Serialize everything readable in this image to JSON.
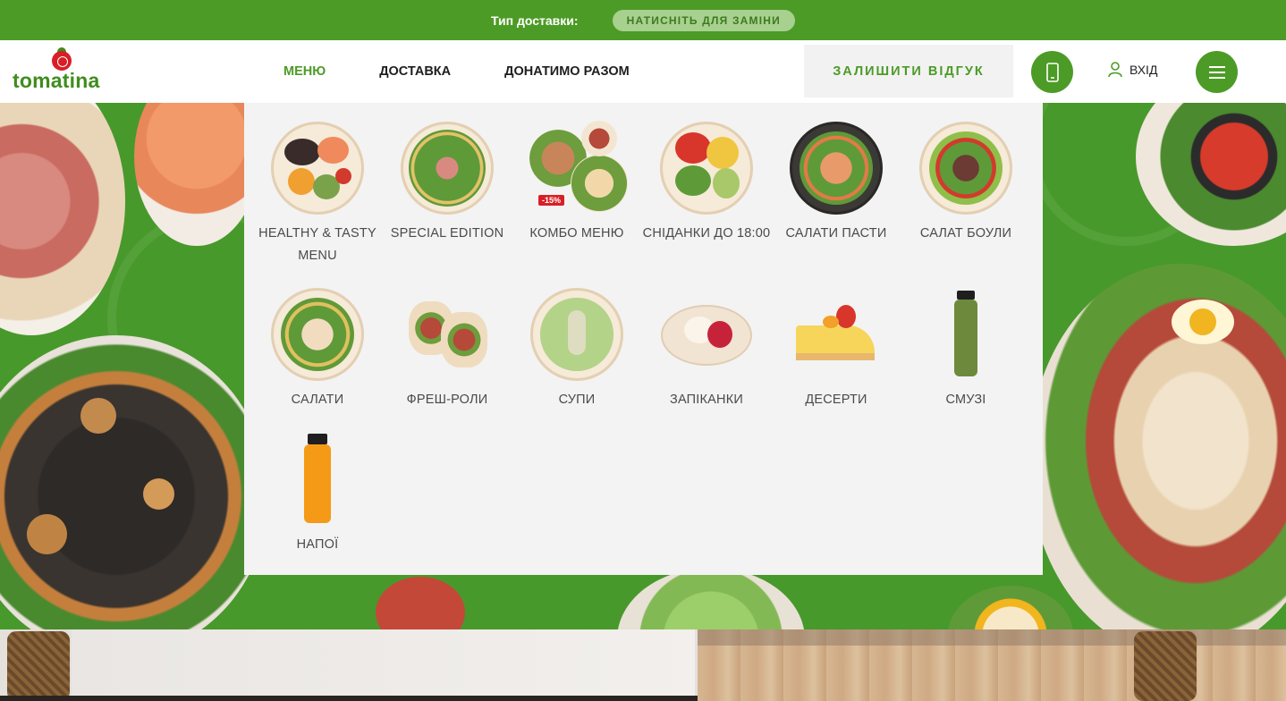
{
  "topbar": {
    "label": "Тип доставки:",
    "button": "НАТИСНІТЬ ДЛЯ ЗАМІНИ"
  },
  "logo": {
    "text": "tomatina"
  },
  "nav": {
    "items": [
      "МЕНЮ",
      "ДОСТАВКА",
      "ДОНАТИМО РАЗОМ"
    ],
    "active": "МЕНЮ"
  },
  "header": {
    "review_button": "ЗАЛИШИТИ ВІДГУК",
    "login_label": "ВХІД"
  },
  "menu_categories": [
    {
      "label": "HEALTHY & TASTY MENU",
      "icon": "bowl-healthy"
    },
    {
      "label": "SPECIAL EDITION",
      "icon": "salad-prosciutto"
    },
    {
      "label": "КОМБО МЕНЮ",
      "icon": "combo-plates",
      "badge": "-15%"
    },
    {
      "label": "СНІДАНКИ ДО 18:00",
      "icon": "breakfast-plate"
    },
    {
      "label": "САЛАТИ ПАСТИ",
      "icon": "shrimp-salad"
    },
    {
      "label": "САЛАТ БОУЛИ",
      "icon": "salad-bowl"
    },
    {
      "label": "САЛАТИ",
      "icon": "chicken-salad"
    },
    {
      "label": "ФРЕШ-РОЛИ",
      "icon": "wrap-rolls"
    },
    {
      "label": "СУПИ",
      "icon": "cream-soup"
    },
    {
      "label": "ЗАПІКАНКИ",
      "icon": "casserole"
    },
    {
      "label": "ДЕСЕРТИ",
      "icon": "cheesecake"
    },
    {
      "label": "СМУЗІ",
      "icon": "smoothie-bottle"
    },
    {
      "label": "НАПОЇ",
      "icon": "juice-bottle"
    }
  ],
  "colors": {
    "brand_green": "#4c9b26",
    "tomato_red": "#d81f26",
    "panel_bg": "#f3f3f3"
  }
}
